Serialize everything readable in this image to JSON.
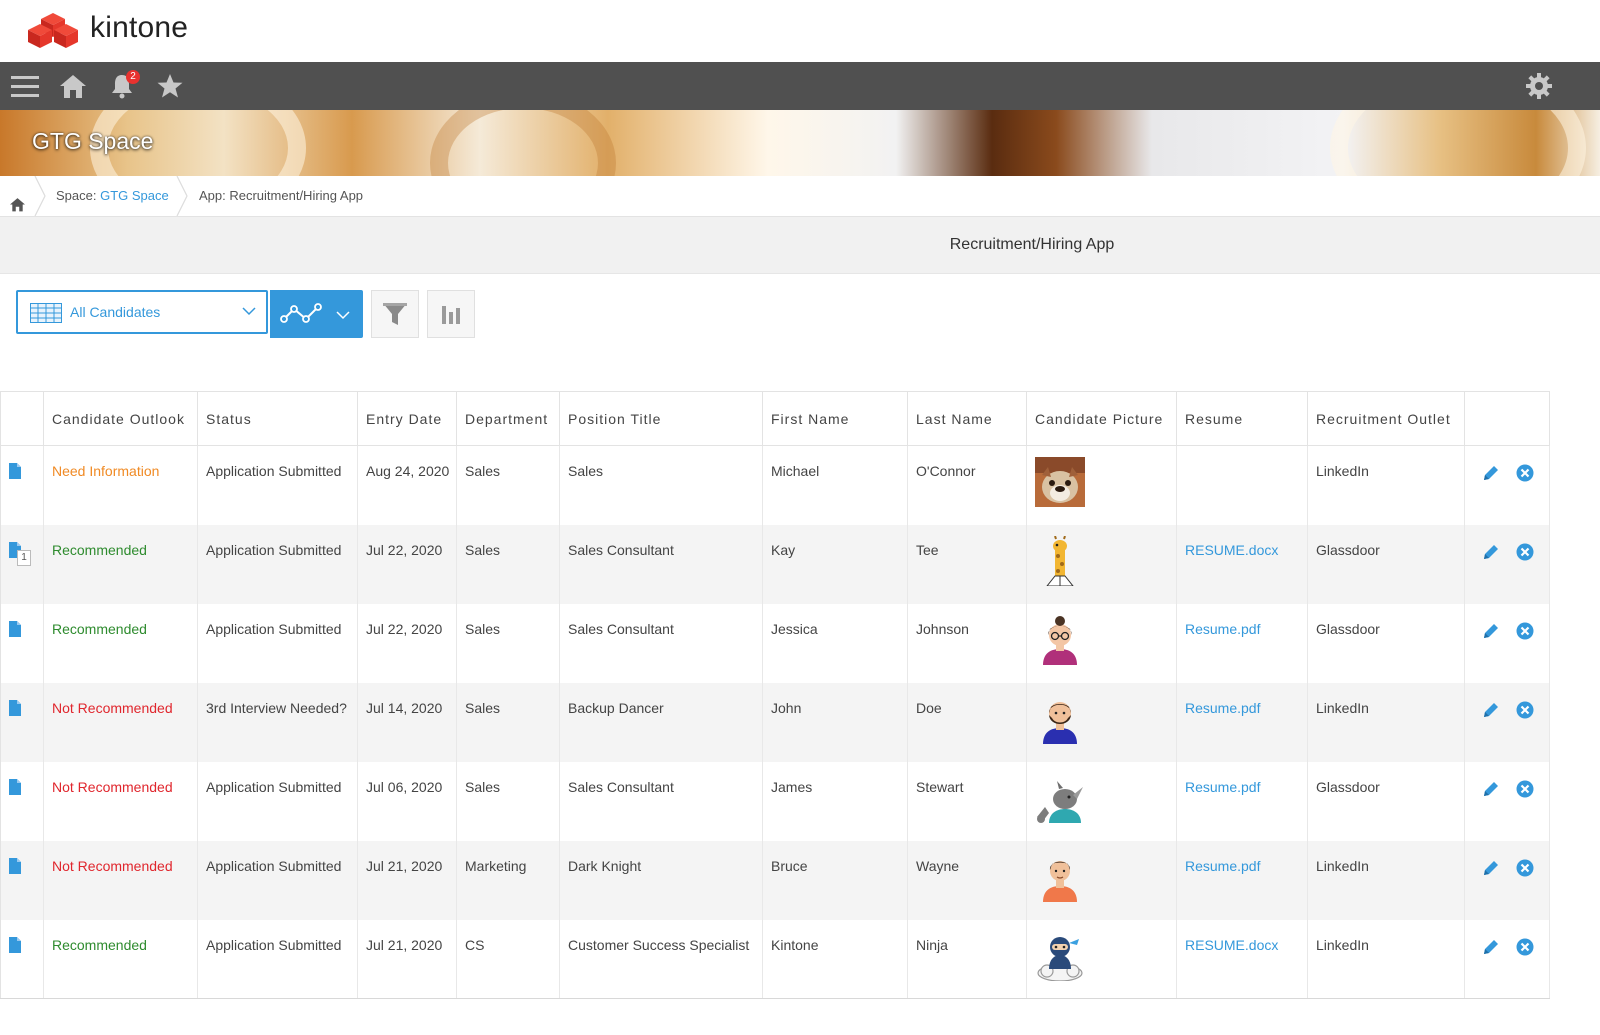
{
  "brand": {
    "name": "kintone",
    "color": "#e8322f"
  },
  "nav": {
    "notification_count": "2",
    "icons": [
      "menu-icon",
      "home-icon",
      "bell-icon",
      "star-icon",
      "gear-icon"
    ]
  },
  "space": {
    "title": "GTG Space"
  },
  "breadcrumb": {
    "space_prefix": "Space: ",
    "space_name": "GTG Space",
    "app_prefix": "App: ",
    "app_name": "Recruitment/Hiring App"
  },
  "app": {
    "title": "Recruitment/Hiring App"
  },
  "toolbar": {
    "view_name": "All Candidates",
    "accent": "#3498db"
  },
  "table": {
    "headers": [
      "Candidate Outlook",
      "Status",
      "Entry Date",
      "Department",
      "Position Title",
      "First Name",
      "Last Name",
      "Candidate Picture",
      "Resume",
      "Recruitment Outlet"
    ],
    "rows": [
      {
        "outlook": "Need Information",
        "outlook_color": "#f08a24",
        "status": "Application Submitted",
        "entry_date": "Aug 24, 2020",
        "department": "Sales",
        "position": "Sales",
        "first_name": "Michael",
        "last_name": "O'Connor",
        "picture": "bulldog-photo",
        "resume": "",
        "outlet": "LinkedIn",
        "comments": ""
      },
      {
        "outlook": "Recommended",
        "outlook_color": "#2e8b2e",
        "status": "Application Submitted",
        "entry_date": "Jul 22, 2020",
        "department": "Sales",
        "position": "Sales Consultant",
        "first_name": "Kay",
        "last_name": "Tee",
        "picture": "giraffe-avatar",
        "resume": "RESUME.docx",
        "outlet": "Glassdoor",
        "comments": "1"
      },
      {
        "outlook": "Recommended",
        "outlook_color": "#2e8b2e",
        "status": "Application Submitted",
        "entry_date": "Jul 22, 2020",
        "department": "Sales",
        "position": "Sales Consultant",
        "first_name": "Jessica",
        "last_name": "Johnson",
        "picture": "woman-glasses-avatar",
        "resume": "Resume.pdf",
        "outlet": "Glassdoor",
        "comments": ""
      },
      {
        "outlook": "Not Recommended",
        "outlook_color": "#e0262d",
        "status": "3rd Interview Needed?",
        "entry_date": "Jul 14, 2020",
        "department": "Sales",
        "position": "Backup Dancer",
        "first_name": "John",
        "last_name": "Doe",
        "picture": "bearded-man-avatar",
        "resume": "Resume.pdf",
        "outlet": "LinkedIn",
        "comments": ""
      },
      {
        "outlook": "Not Recommended",
        "outlook_color": "#e0262d",
        "status": "Application Submitted",
        "entry_date": "Jul 06, 2020",
        "department": "Sales",
        "position": "Sales Consultant",
        "first_name": "James",
        "last_name": "Stewart",
        "picture": "rhino-avatar",
        "resume": "Resume.pdf",
        "outlet": "Glassdoor",
        "comments": ""
      },
      {
        "outlook": "Not Recommended",
        "outlook_color": "#e0262d",
        "status": "Application Submitted",
        "entry_date": "Jul 21, 2020",
        "department": "Marketing",
        "position": "Dark Knight",
        "first_name": "Bruce",
        "last_name": "Wayne",
        "picture": "man-orange-shirt-avatar",
        "resume": "Resume.pdf",
        "outlet": "LinkedIn",
        "comments": ""
      },
      {
        "outlook": "Recommended",
        "outlook_color": "#2e8b2e",
        "status": "Application Submitted",
        "entry_date": "Jul 21, 2020",
        "department": "CS",
        "position": "Customer Success Specialist",
        "first_name": "Kintone",
        "last_name": "Ninja",
        "picture": "ninja-cloud-avatar",
        "resume": "RESUME.docx",
        "outlet": "LinkedIn",
        "comments": ""
      }
    ]
  }
}
